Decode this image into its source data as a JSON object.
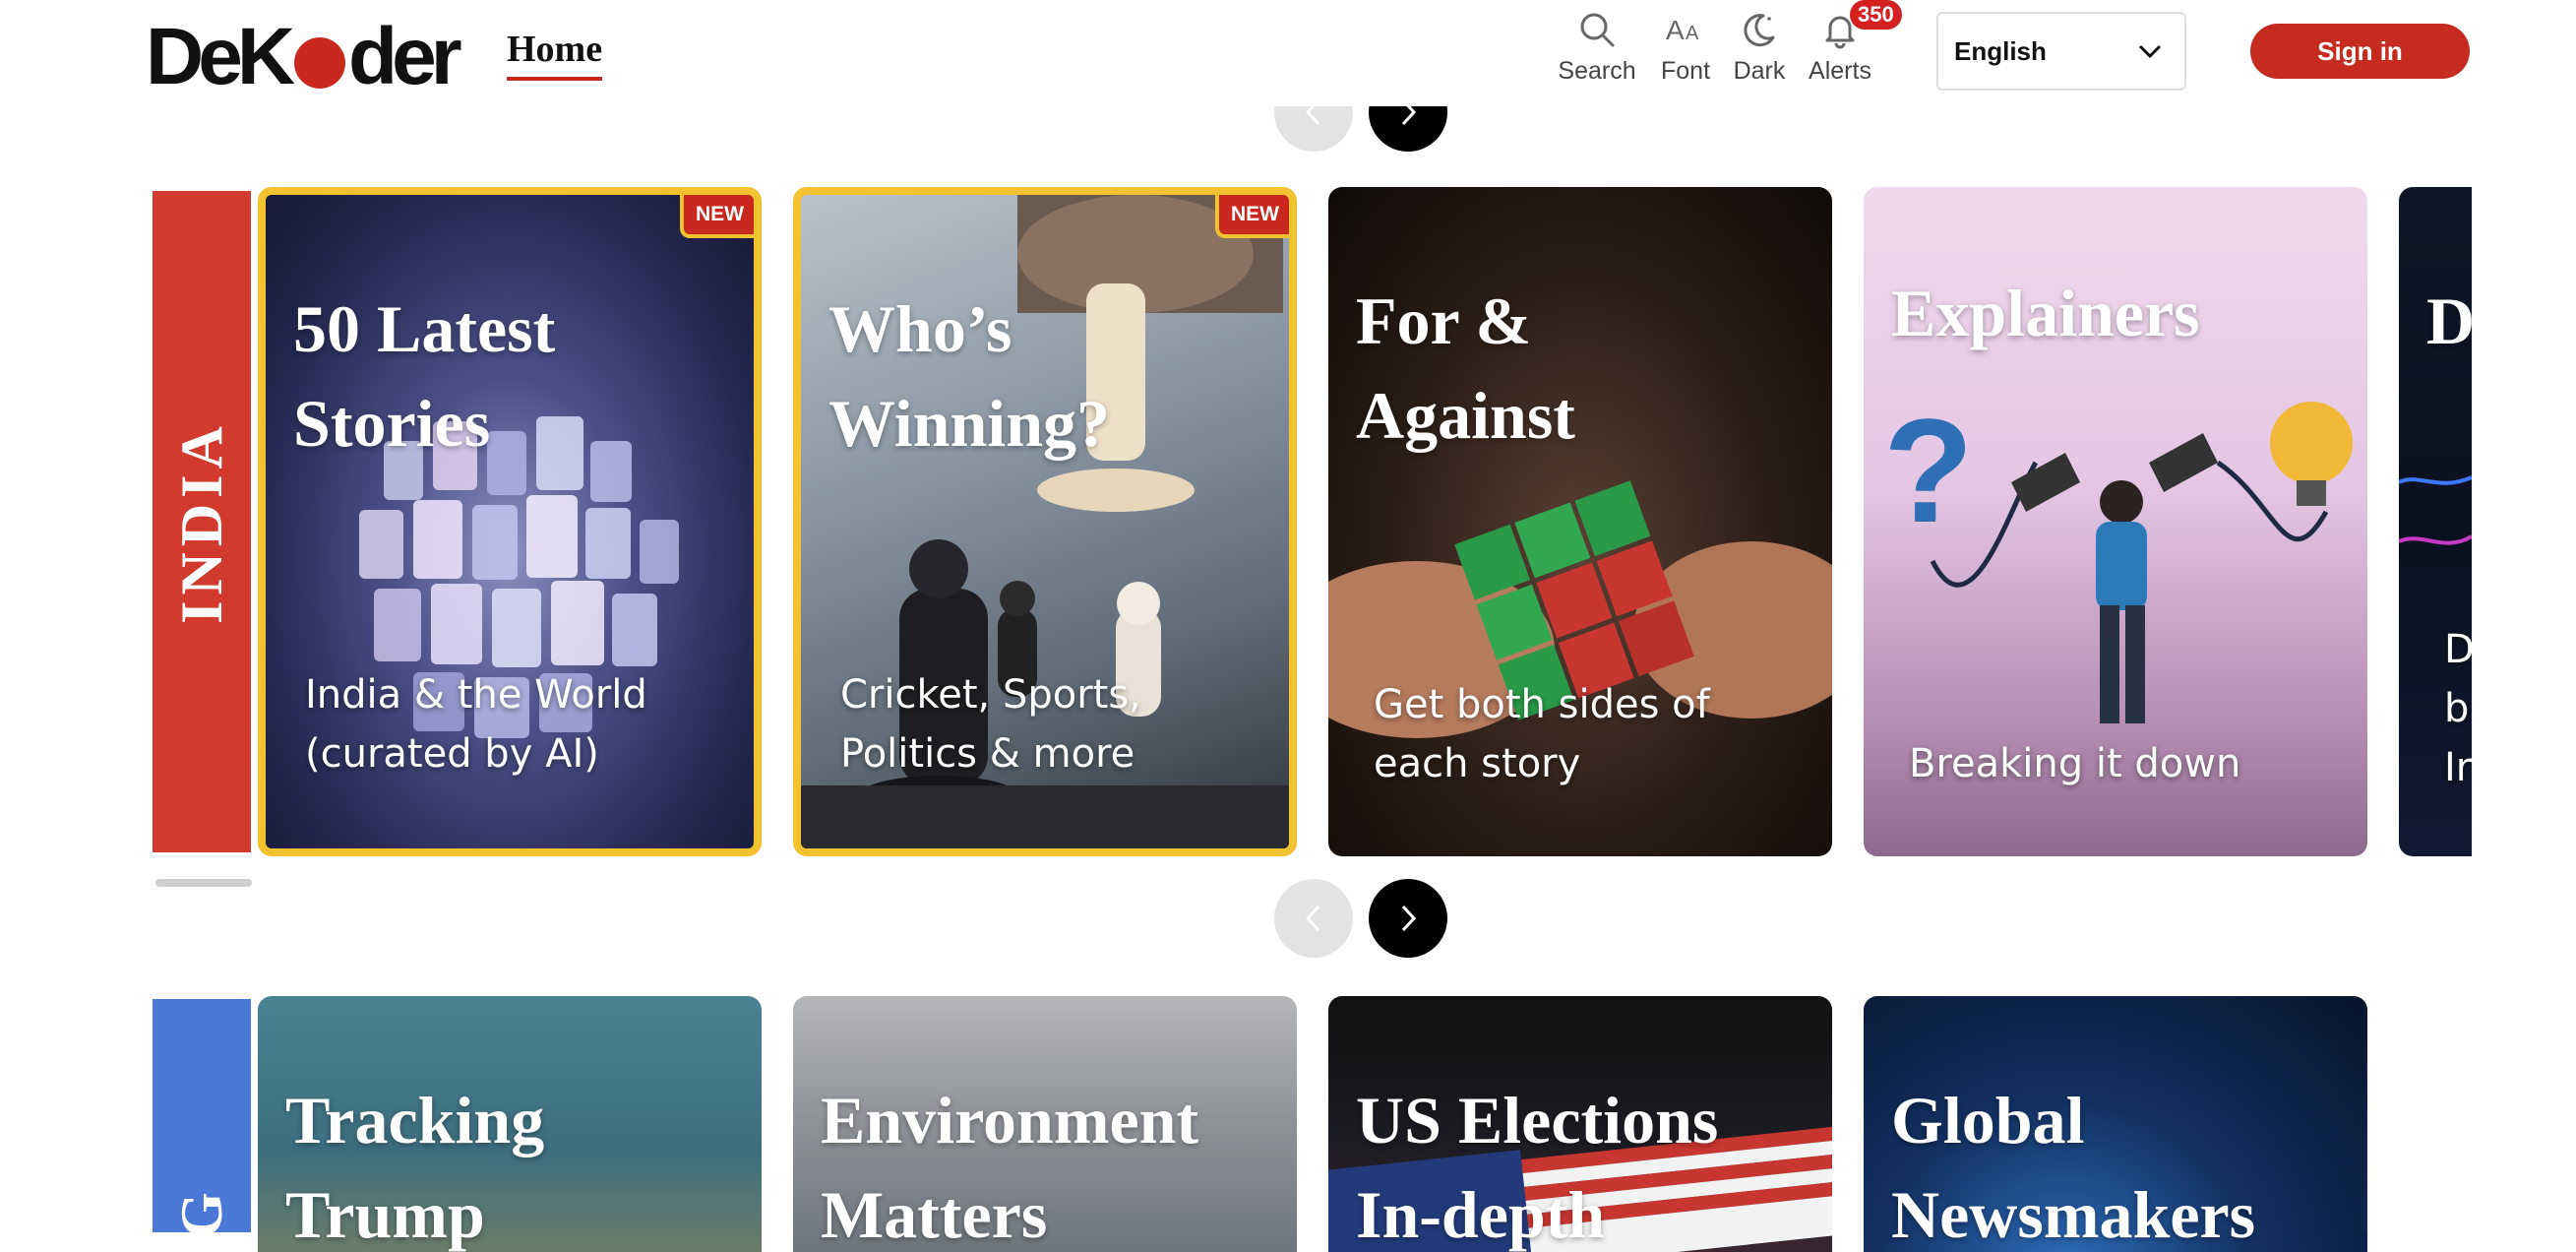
{
  "header": {
    "logo_text": "DeKoder",
    "nav_home": "Home",
    "tools": [
      {
        "label": "Search",
        "icon": "search-icon"
      },
      {
        "label": "Font",
        "icon": "font-size-icon"
      },
      {
        "label": "Dark",
        "icon": "dark-mode-icon"
      },
      {
        "label": "Alerts",
        "icon": "bell-icon",
        "count": "350"
      }
    ],
    "language": {
      "selected": "English"
    },
    "signin_label": "Sign in"
  },
  "colors": {
    "brand_red": "#c62b1f",
    "highlight_gold": "#f2c230",
    "india_tab": "#d23a2e",
    "global_tab": "#4a78d6"
  },
  "row1": {
    "tab_label": "INDIA",
    "cards": [
      {
        "title": "50 Latest\nStories",
        "subtitle": "India & the World\n(curated by AI)",
        "badge": "NEW"
      },
      {
        "title": "Who’s\nWinning?",
        "subtitle": "Cricket, Sports,\nPolitics & more",
        "badge": "NEW"
      },
      {
        "title": "For &\nAgainst",
        "subtitle": "Get both sides of\neach story"
      },
      {
        "title": "Explainers",
        "subtitle": "Breaking it down"
      },
      {
        "title": "D",
        "subtitle": "D\nb\nIr"
      }
    ]
  },
  "row2": {
    "tab_label": "G",
    "cards": [
      {
        "title": "Tracking\nTrump"
      },
      {
        "title": "Environment\nMatters"
      },
      {
        "title": "US Elections\nIn-depth"
      },
      {
        "title": "Global\nNewsmakers"
      }
    ]
  }
}
